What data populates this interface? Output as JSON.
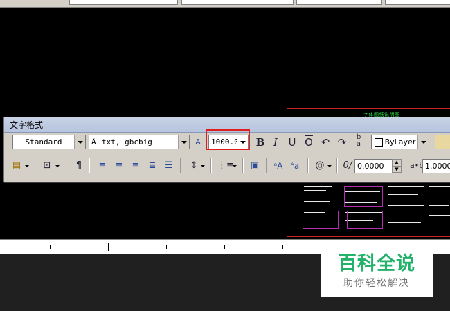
{
  "toolbar": {
    "title": "文字格式",
    "style_value": "Standard",
    "font_value": "txt, gbcbig",
    "height_value": "1000.0",
    "color_value": "ByLayer",
    "oblique_value": "0.0000",
    "tracking_value": "1.0000",
    "bold_label": "B",
    "italic_label": "I",
    "underline_label": "U",
    "overline_label": "O"
  },
  "drawing": {
    "title_text": "字体图纸说明图",
    "frame_color": "#d0202a",
    "title_color": "#2ae04a"
  },
  "watermark": {
    "title": "百科全说",
    "subtitle": "助你轻松解决",
    "title_color": "#23b26a"
  },
  "icons": [
    "text-height-icon",
    "undo-icon",
    "redo-icon",
    "stack-icon",
    "justification-icon",
    "paragraph-icon",
    "align-left-icon",
    "align-center-icon",
    "align-right-icon",
    "justify-icon",
    "distribute-icon",
    "line-spacing-icon",
    "numbering-icon",
    "insert-field-icon",
    "uppercase-icon",
    "lowercase-icon",
    "symbol-icon",
    "oblique-icon",
    "tracking-icon",
    "ruler-icon",
    "columns-icon"
  ]
}
